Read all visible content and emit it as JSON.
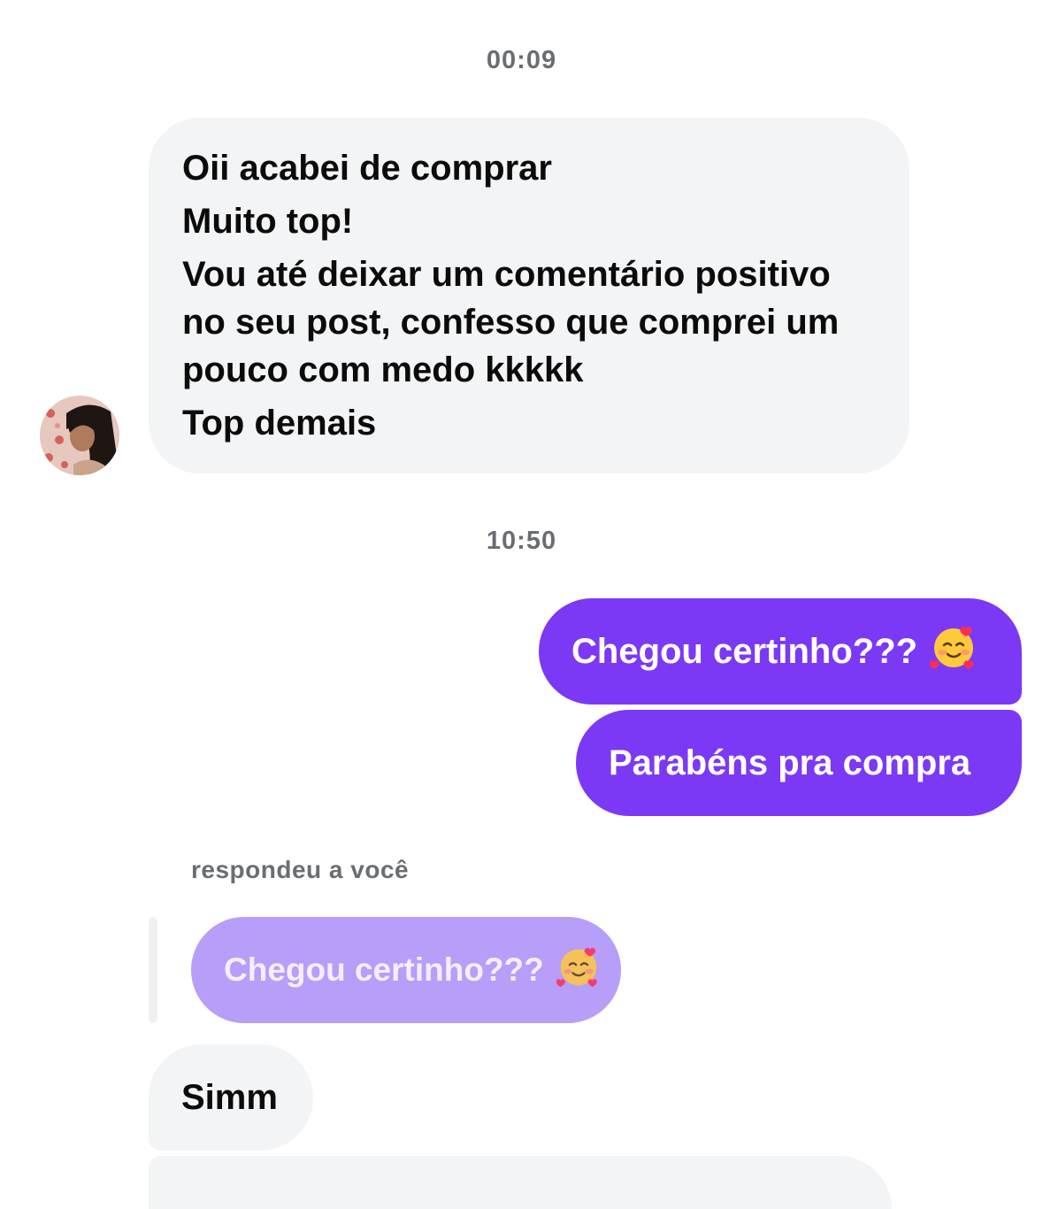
{
  "thread": {
    "timestamp_1": "00:09",
    "timestamp_2": "10:50"
  },
  "messages": {
    "incoming_1": {
      "lines": [
        "Oii acabei de comprar",
        "Muito top!",
        "Vou até deixar um comentário positivo",
        "no seu post, confesso que comprei um",
        "pouco com medo kkkkk",
        "Top demais"
      ]
    },
    "outgoing_1": {
      "text": "Chegou certinho???",
      "emoji_icon": "smiling-face-with-hearts-icon"
    },
    "outgoing_2": {
      "text": "Parabéns pra compra"
    },
    "reply": {
      "label": "respondeu a você",
      "quoted_text": "Chegou certinho???",
      "quoted_emoji_icon": "smiling-face-with-hearts-icon"
    },
    "incoming_2": {
      "text": "Simm"
    }
  },
  "colors": {
    "outgoing_bubble": "#7b39f5",
    "incoming_bubble": "#f3f4f6",
    "quoted_bubble": "#b69ef9",
    "timestamp_text": "#6a6d72"
  }
}
